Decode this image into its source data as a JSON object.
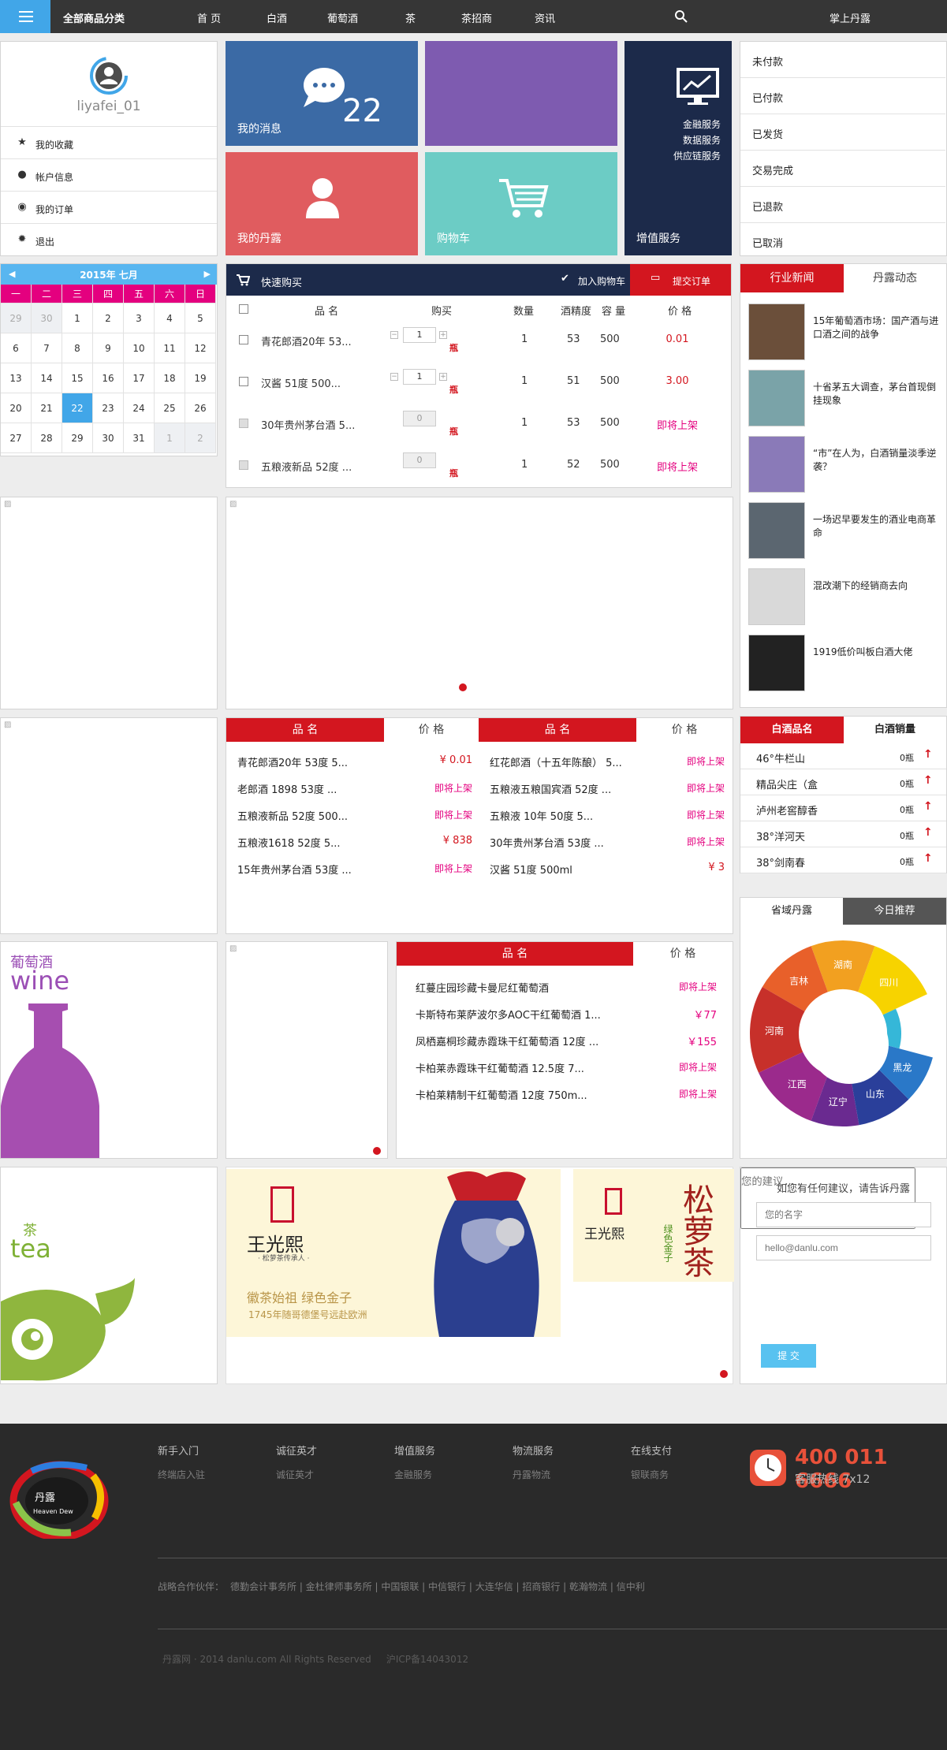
{
  "nav": {
    "category": "全部商品分类",
    "links": [
      "首 页",
      "白酒",
      "葡萄酒",
      "茶",
      "茶招商",
      "资讯"
    ],
    "mobile": "掌上丹露"
  },
  "user": {
    "name": "liyafei_01",
    "menu": [
      "我的收藏",
      "帐户信息",
      "我的订单",
      "退出"
    ]
  },
  "tiles": {
    "messages": "我的消息",
    "message_count": "22",
    "danlu": "我的丹露",
    "cart": "购物车",
    "value": "增值服务",
    "value_items": [
      "金融服务",
      "数据服务",
      "供应链服务"
    ]
  },
  "orders": [
    "未付款",
    "已付款",
    "已发货",
    "交易完成",
    "已退款",
    "已取消"
  ],
  "calendar": {
    "title": "2015年 七月",
    "weekdays": [
      "一",
      "二",
      "三",
      "四",
      "五",
      "六",
      "日"
    ],
    "days": [
      "29",
      "30",
      "1",
      "2",
      "3",
      "4",
      "5",
      "6",
      "7",
      "8",
      "9",
      "10",
      "11",
      "12",
      "13",
      "14",
      "15",
      "16",
      "17",
      "18",
      "19",
      "20",
      "21",
      "22",
      "23",
      "24",
      "25",
      "26",
      "27",
      "28",
      "29",
      "30",
      "31",
      "1",
      "2"
    ],
    "today": "22"
  },
  "quick": {
    "title": "快速购买",
    "add_cart": "加入购物车",
    "submit": "提交订单",
    "headers": [
      "品 名",
      "购买",
      "数量",
      "酒精度",
      "容 量",
      "价 格"
    ],
    "rows": [
      {
        "name": "青花郎酒20年 53...",
        "qty": "1",
        "unit": "瓶",
        "count": "1",
        "abv": "53",
        "vol": "500",
        "price": "0.01"
      },
      {
        "name": "汉酱 51度 500...",
        "qty": "1",
        "unit": "瓶",
        "count": "1",
        "abv": "51",
        "vol": "500",
        "price": "3.00"
      },
      {
        "name": "30年贵州茅台酒 5...",
        "qty": "0",
        "unit": "瓶",
        "count": "1",
        "abv": "53",
        "vol": "500",
        "price": "即将上架"
      },
      {
        "name": "五粮液新品 52度 ...",
        "qty": "0",
        "unit": "瓶",
        "count": "1",
        "abv": "52",
        "vol": "500",
        "price": "即将上架"
      }
    ]
  },
  "news": {
    "tabs": [
      "行业新闻",
      "丹露动态"
    ],
    "items": [
      "15年葡萄酒市场：国产酒与进口酒之间的战争",
      "十省茅五大调查，茅台首现倒挂现象",
      "“市”在人为，白酒销量淡季逆袭？",
      "一场迟早要发生的酒业电商革命",
      "混改潮下的经销商去向",
      "1919低价叫板白酒大佬"
    ]
  },
  "baijiu_list": {
    "h_name": "品 名",
    "h_price": "价 格",
    "left": [
      {
        "name": "青花郎酒20年 53度 5...",
        "price": "¥ 0.01"
      },
      {
        "name": "老郎酒 1898 53度 ...",
        "price": "即将上架"
      },
      {
        "name": "五粮液新品 52度 500...",
        "price": "即将上架"
      },
      {
        "name": "五粮液1618 52度 5...",
        "price": "¥ 838"
      },
      {
        "name": "15年贵州茅台酒 53度 ...",
        "price": "即将上架"
      }
    ],
    "right": [
      {
        "name": "红花郎酒（十五年陈酿） 5...",
        "price": "即将上架"
      },
      {
        "name": "五粮液五粮国宾酒 52度 ...",
        "price": "即将上架"
      },
      {
        "name": "五粮液 10年 50度 5...",
        "price": "即将上架"
      },
      {
        "name": "30年贵州茅台酒 53度 ...",
        "price": "即将上架"
      },
      {
        "name": "汉酱 51度 500ml",
        "price": "¥ 3"
      }
    ]
  },
  "rank": {
    "tabs": [
      "白酒品名",
      "白酒销量"
    ],
    "items": [
      {
        "name": "46°牛栏山",
        "sales": "0瓶"
      },
      {
        "name": "精品尖庄（盒",
        "sales": "0瓶"
      },
      {
        "name": "泸州老窖醇香",
        "sales": "0瓶"
      },
      {
        "name": "38°洋河天",
        "sales": "0瓶"
      },
      {
        "name": "38°剑南春",
        "sales": "0瓶"
      }
    ]
  },
  "region": {
    "tabs": [
      "省域丹露",
      "今日推荐"
    ],
    "provinces": [
      "四川",
      "湖南",
      "吉林",
      "河南",
      "江西",
      "辽宁",
      "山东",
      "黑龙"
    ]
  },
  "wine": {
    "cn": "葡萄酒",
    "en": "wine",
    "h_name": "品 名",
    "h_price": "价 格",
    "items": [
      {
        "name": "红蔓庄园珍藏卡曼尼红葡萄酒",
        "price": "即将上架"
      },
      {
        "name": "卡斯特布莱萨波尔多AOC干红葡萄酒 1...",
        "price": "￥77"
      },
      {
        "name": "凤栖嘉桐珍藏赤霞珠干红葡萄酒 12度 ...",
        "price": "￥155"
      },
      {
        "name": "卡柏莱赤霞珠干红葡萄酒 12.5度 7...",
        "price": "即将上架"
      },
      {
        "name": "卡柏莱精制干红葡萄酒 12度 750m...",
        "price": "即将上架"
      }
    ]
  },
  "tea": {
    "cn": "茶",
    "en": "tea",
    "brand": "王光熙",
    "brand_sub": "· 松萝茶传承人 ·",
    "slogan": "徽茶始祖 绿色金子",
    "slogan2": "1745年随哥德堡号远赴欧洲",
    "songluo": "松萝茶",
    "green_gold": "绿色金子"
  },
  "feedback": {
    "title": "如您有任何建议，请告诉丹露",
    "name_ph": "您的名字",
    "email_ph": "hello@danlu.com",
    "msg_ph": "您的建议...",
    "submit": "提 交"
  },
  "footer": {
    "brand": "丹露",
    "brand_en": "Heaven Dew",
    "cols": [
      {
        "title": "新手入门",
        "item": "终端店入驻"
      },
      {
        "title": "诚征英才",
        "item": "诚征英才"
      },
      {
        "title": "增值服务",
        "item": "金融服务"
      },
      {
        "title": "物流服务",
        "item": "丹露物流"
      },
      {
        "title": "在线支付",
        "item": "银联商务"
      }
    ],
    "phone": "400 011 6666",
    "hotline": "客服热线 7x12",
    "partners_label": "战略合作伙伴：",
    "partners": "德勤会计事务所 |  金杜律师事务所 |  中国银联 |  中信银行 |  大连华信 |  招商银行 |  乾瀚物流 |  信中利",
    "copyright": "丹露网 · 2014 danlu.com All Rights Reserved     沪ICP备14043012"
  },
  "colors": {
    "accent": "#41a6e8",
    "red": "#d3161f",
    "pink": "#e4007f",
    "navy": "#1c2a4a"
  }
}
